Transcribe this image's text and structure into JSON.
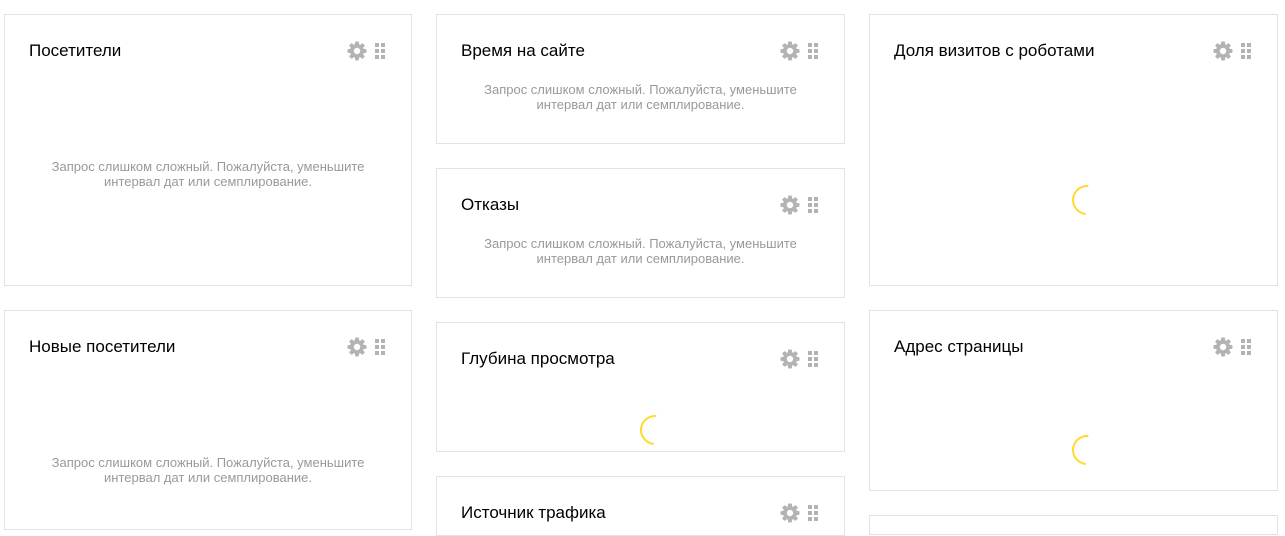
{
  "widgets": {
    "visitors": {
      "title": "Посетители",
      "message_line1": "Запрос слишком сложный. Пожалуйста, уменьшите",
      "message_line2": "интервал дат или семплирование."
    },
    "time_on_site": {
      "title": "Время на сайте",
      "message_line1": "Запрос слишком сложный. Пожалуйста, уменьшите",
      "message_line2": "интервал дат или семплирование."
    },
    "robot_share": {
      "title": "Доля визитов с роботами"
    },
    "bounces": {
      "title": "Отказы",
      "message_line1": "Запрос слишком сложный. Пожалуйста, уменьшите",
      "message_line2": "интервал дат или семплирование."
    },
    "new_visitors": {
      "title": "Новые посетители",
      "message_line1": "Запрос слишком сложный. Пожалуйста, уменьшите",
      "message_line2": "интервал дат или семплирование."
    },
    "page_depth": {
      "title": "Глубина просмотра"
    },
    "page_address": {
      "title": "Адрес страницы"
    },
    "traffic_source": {
      "title": "Источник трафика"
    }
  },
  "icons": {
    "settings": "gear-icon",
    "drag": "drag-handle-icon"
  },
  "colors": {
    "spinner": "#ffd92e",
    "message": "#999999",
    "icon": "#b3b3b3",
    "border": "#e2e2e2"
  }
}
